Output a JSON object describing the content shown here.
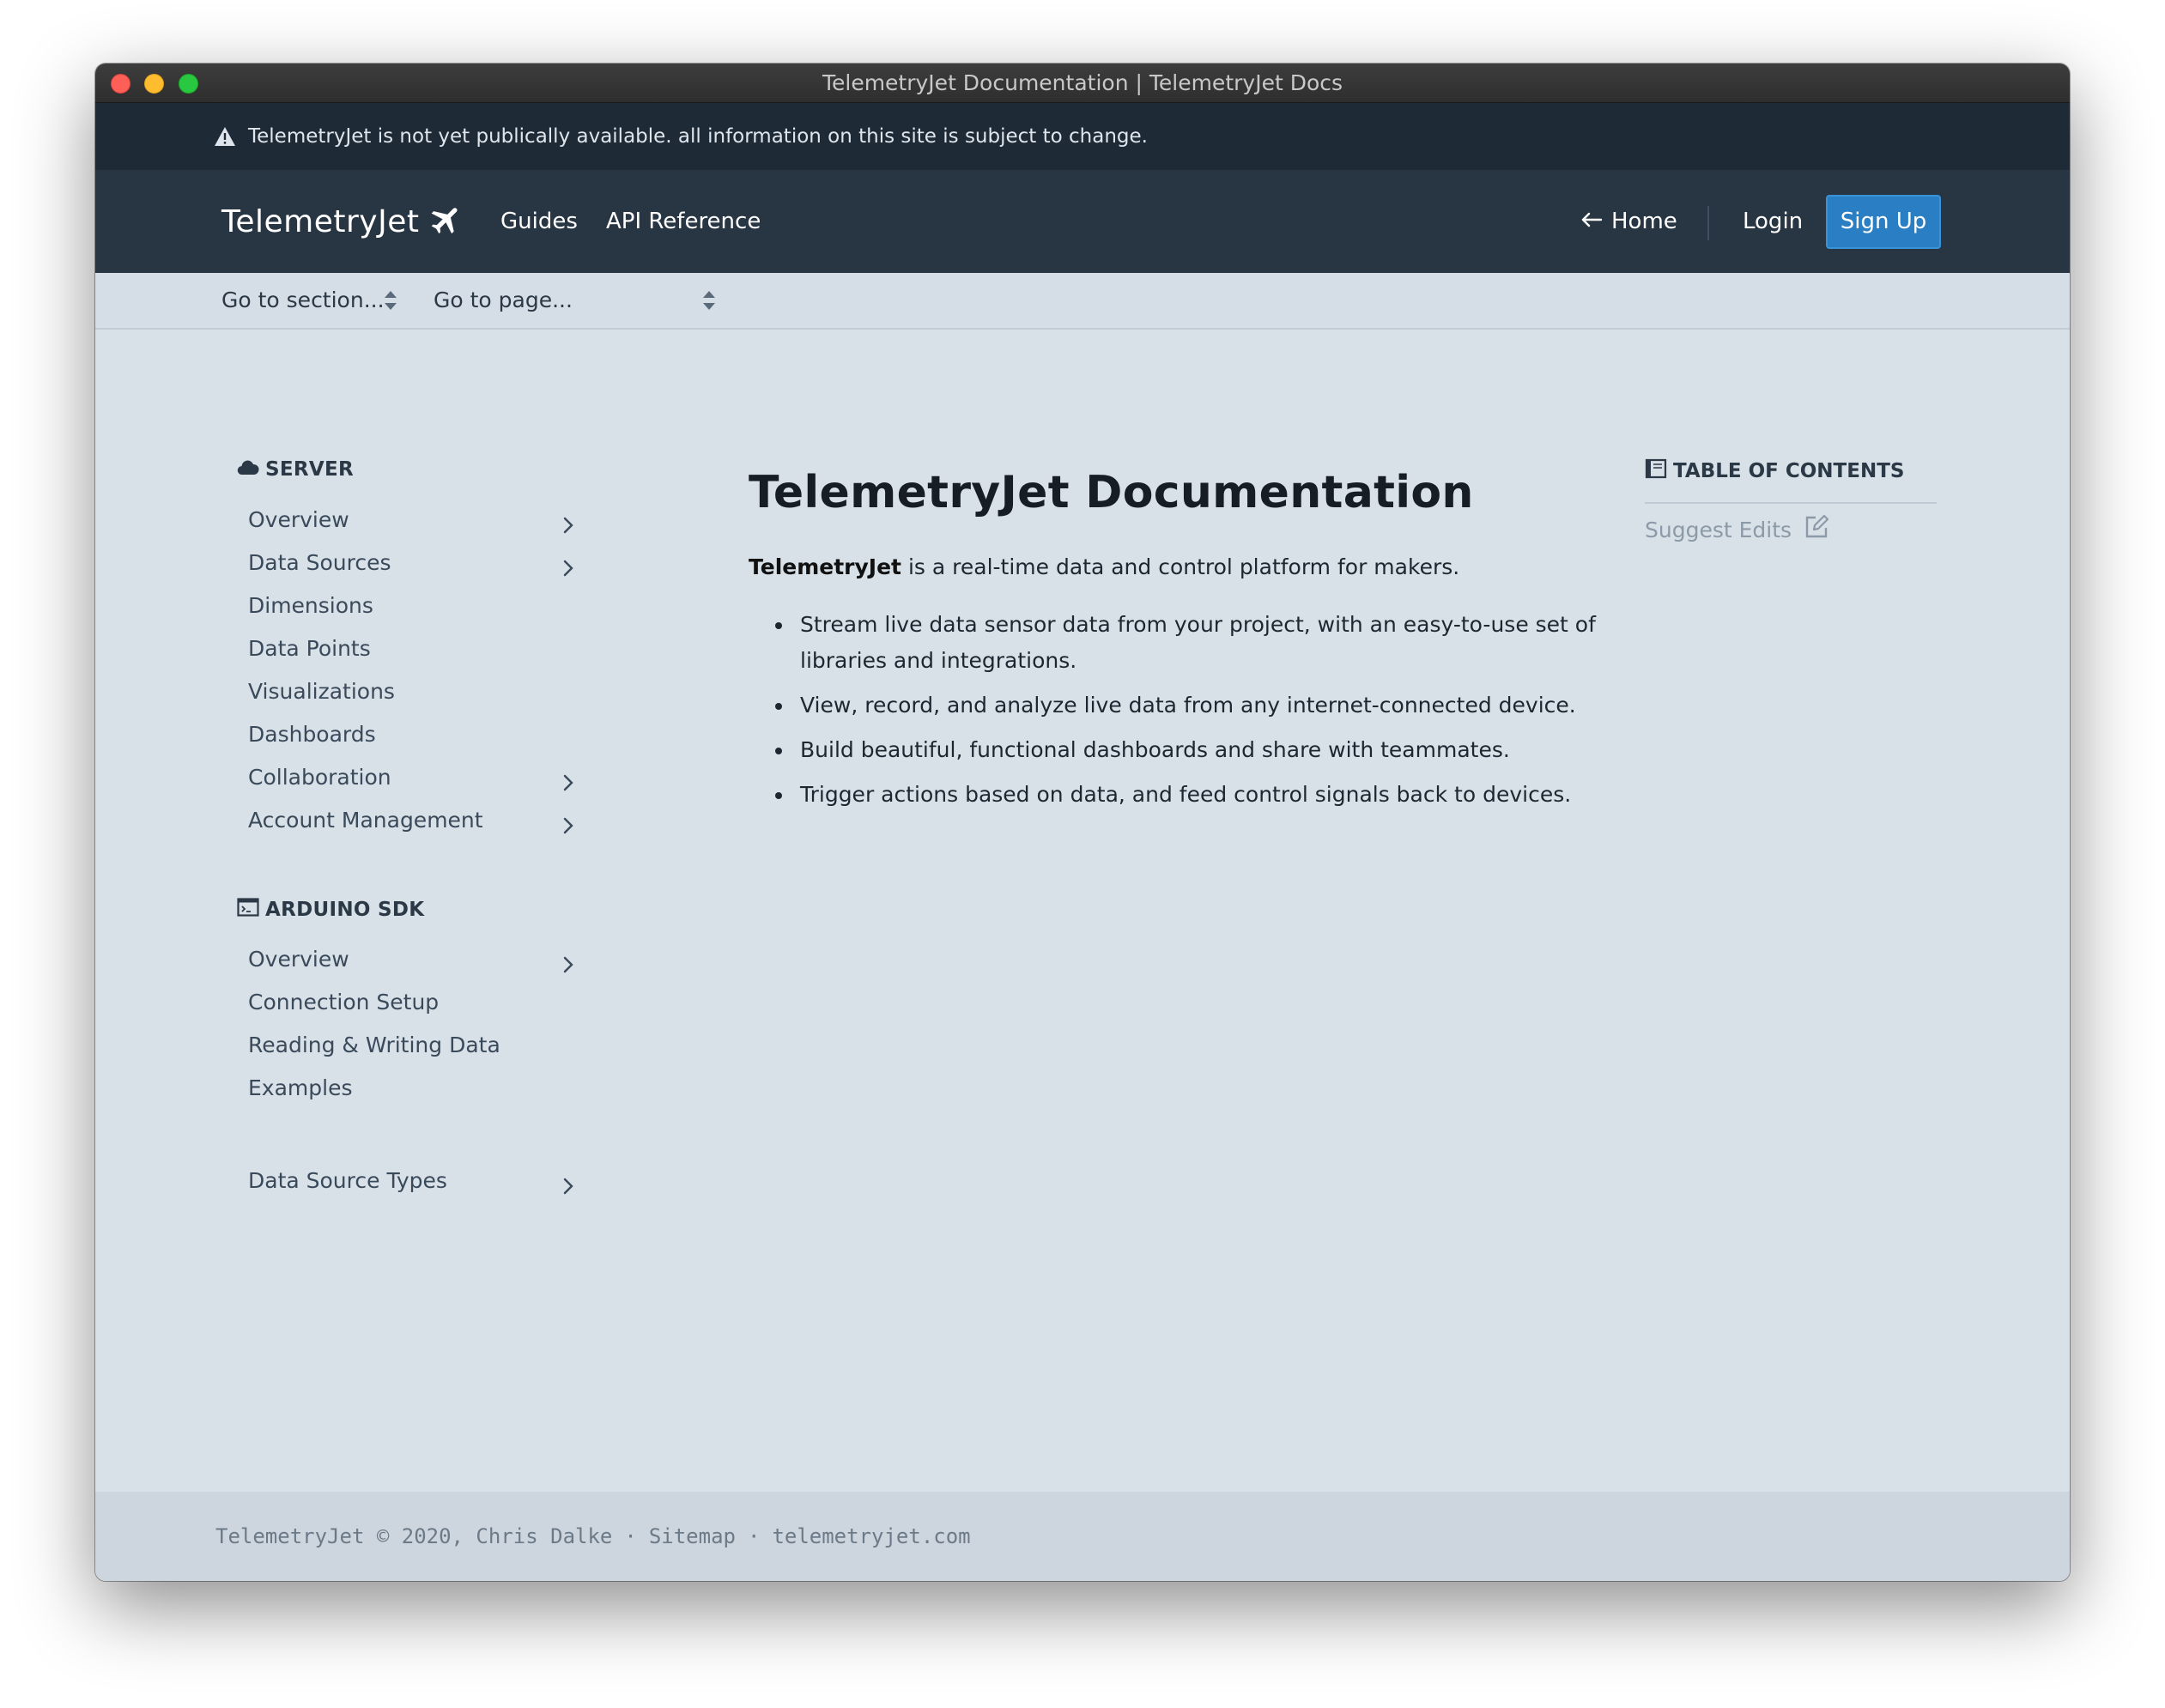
{
  "window": {
    "title": "TelemetryJet Documentation | TelemetryJet Docs"
  },
  "announcement": {
    "icon": "warning-icon",
    "text": "TelemetryJet is not yet publically available. all information on this site is subject to change."
  },
  "navbar": {
    "brand": "TelemetryJet",
    "brand_icon": "airplane-icon",
    "links": {
      "guides": "Guides",
      "api": "API Reference"
    },
    "home": "Home",
    "login": "Login",
    "signup": "Sign Up",
    "accent": "#2a7fc4"
  },
  "subnav": {
    "section_placeholder": "Go to section...",
    "page_placeholder": "Go to page..."
  },
  "sidebar": {
    "server": {
      "heading": "SERVER",
      "icon": "cloud-icon",
      "items": [
        {
          "label": "Overview",
          "expandable": true
        },
        {
          "label": "Data Sources",
          "expandable": true
        },
        {
          "label": "Dimensions",
          "expandable": false
        },
        {
          "label": "Data Points",
          "expandable": false
        },
        {
          "label": "Visualizations",
          "expandable": false
        },
        {
          "label": "Dashboards",
          "expandable": false
        },
        {
          "label": "Collaboration",
          "expandable": true
        },
        {
          "label": "Account Management",
          "expandable": true
        }
      ]
    },
    "arduino": {
      "heading": "ARDUINO SDK",
      "icon": "terminal-icon",
      "items": [
        {
          "label": "Overview",
          "expandable": true
        },
        {
          "label": "Connection Setup",
          "expandable": false
        },
        {
          "label": "Reading & Writing Data",
          "expandable": false
        },
        {
          "label": "Examples",
          "expandable": false
        }
      ]
    },
    "extra": {
      "label": "Data Source Types",
      "expandable": true
    }
  },
  "content": {
    "title": "TelemetryJet Documentation",
    "intro_bold": "TelemetryJet",
    "intro_rest": " is a real-time data and control platform for makers.",
    "bullets": [
      "Stream live data sensor data from your project, with an easy-to-use set of libraries and integrations.",
      "View, record, and analyze live data from any internet-connected device.",
      "Build beautiful, functional dashboards and share with teammates.",
      "Trigger actions based on data, and feed control signals back to devices."
    ]
  },
  "toc": {
    "heading": "TABLE OF CONTENTS",
    "icon": "book-icon",
    "suggest": "Suggest Edits",
    "suggest_icon": "edit-icon"
  },
  "footer": {
    "copyright": "TelemetryJet © 2020, Chris Dalke",
    "sep": "·",
    "sitemap": "Sitemap",
    "site": "telemetryjet.com"
  }
}
